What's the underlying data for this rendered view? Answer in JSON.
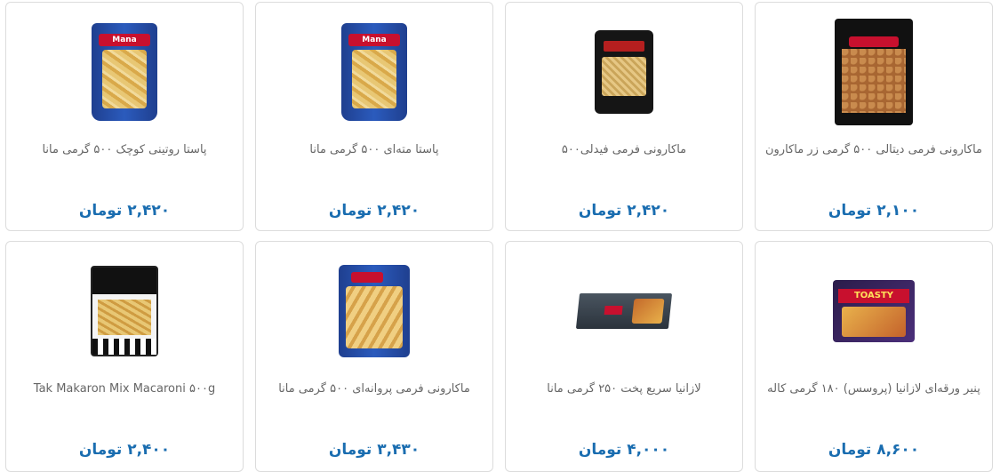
{
  "products": [
    {
      "id": "p1",
      "title": "ماکارونی فرمی دیتالی ۵۰۰ گرمی زر ماکارون",
      "price": "۲,۱۰۰ تومان",
      "package_brand_text": "Zar"
    },
    {
      "id": "p2",
      "title": "ماکارونی فرمی فیدلی۵۰۰",
      "price": "۲,۴۲۰ تومان"
    },
    {
      "id": "p3",
      "title": "پاستا مته‌ای ۵۰۰ گرمی مانا",
      "price": "۲,۴۲۰ تومان",
      "package_brand_text": "Mana"
    },
    {
      "id": "p4",
      "title": "پاستا روتینی کوچک ۵۰۰ گرمی مانا",
      "price": "۲,۴۲۰ تومان",
      "package_brand_text": "Mana"
    },
    {
      "id": "p5",
      "title": "پنیر ورقه‌ای لازانیا (پروسس) ۱۸۰ گرمی کاله",
      "price": "۸,۶۰۰ تومان",
      "package_brand_text": "TOASTY"
    },
    {
      "id": "p6",
      "title": "لازانیا سریع پخت ۲۵۰ گرمی مانا",
      "price": "۴,۰۰۰ تومان"
    },
    {
      "id": "p7",
      "title": "ماکارونی فرمی پروانه‌ای ۵۰۰ گرمی مانا",
      "price": "۳,۴۳۰ تومان"
    },
    {
      "id": "p8",
      "title": "Tak Makaron Mix Macaroni ۵۰۰g",
      "price": "۲,۴۰۰ تومان"
    }
  ],
  "colors": {
    "price": "#1a6db0",
    "title": "#666666",
    "card_border": "#dcdcdc"
  }
}
